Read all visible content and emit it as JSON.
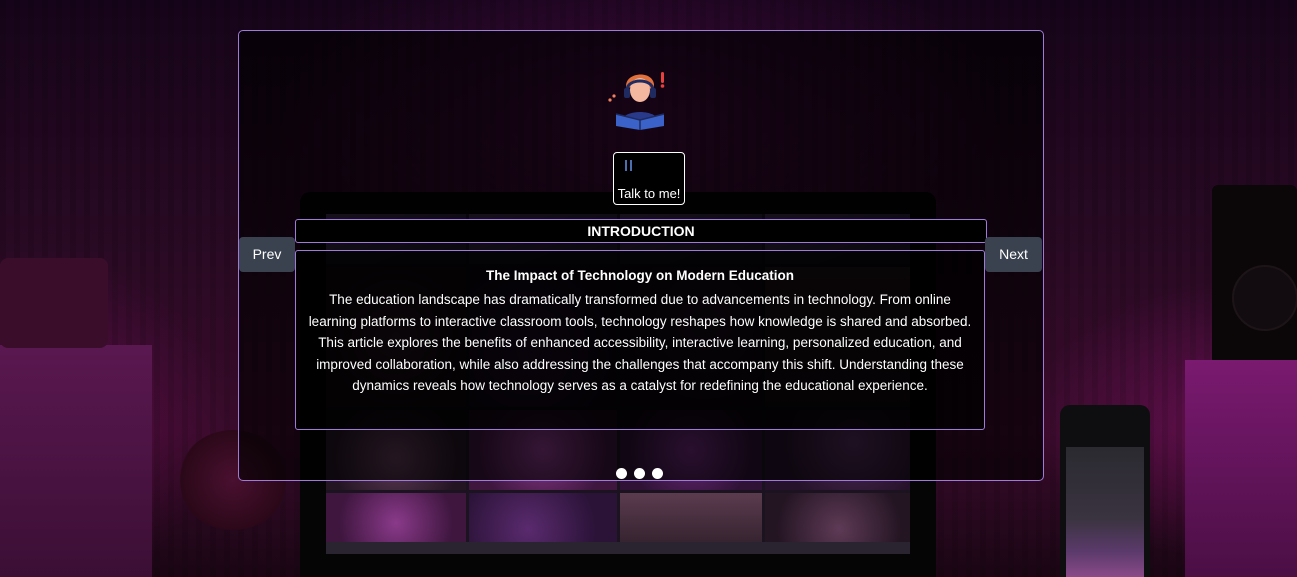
{
  "assistant": {
    "avatar_icon": "reading-student-icon",
    "talk_button_label": "Talk to me!",
    "talk_button_icon": "pause-icon"
  },
  "slider": {
    "section_title": "INTRODUCTION",
    "article_title": "The Impact of Technology on Modern Education",
    "article_body": "The education landscape has dramatically transformed due to advancements in technology. From online learning platforms to interactive classroom tools, technology reshapes how knowledge is shared and absorbed. This article explores the benefits of enhanced accessibility, interactive learning, personalized education, and improved collaboration, while also addressing the challenges that accompany this shift. Understanding these dynamics reveals how technology serves as a catalyst for redefining the educational experience.",
    "prev_label": "Prev",
    "next_label": "Next",
    "dot_count": 3
  },
  "colors": {
    "card_border": "#a07ad8",
    "nav_button_bg": "#3a4250",
    "dot": "#ffffff"
  }
}
